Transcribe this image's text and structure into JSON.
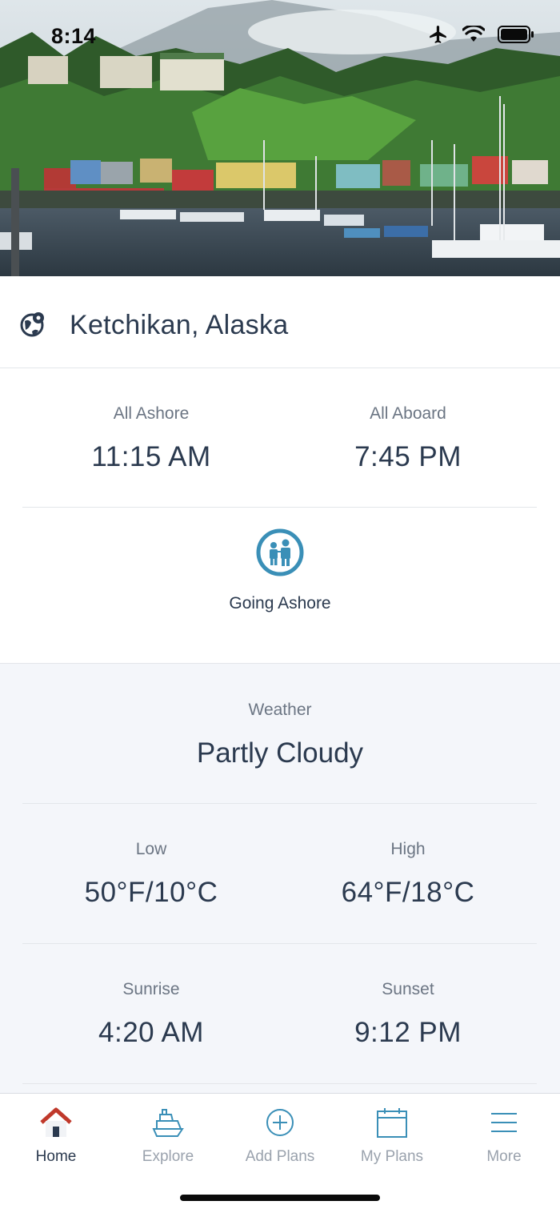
{
  "status_bar": {
    "time": "8:14",
    "icons": [
      "airplane-icon",
      "wifi-icon",
      "battery-icon"
    ]
  },
  "location": {
    "icon": "globe-pin-icon",
    "name": "Ketchikan, Alaska"
  },
  "port_times": {
    "all_ashore_label": "All Ashore",
    "all_ashore_value": "11:15 AM",
    "all_aboard_label": "All Aboard",
    "all_aboard_value": "7:45 PM"
  },
  "going_ashore": {
    "icon": "people-icon",
    "label": "Going Ashore"
  },
  "weather": {
    "label": "Weather",
    "condition": "Partly Cloudy",
    "low_label": "Low",
    "low_value": "50°F/10°C",
    "high_label": "High",
    "high_value": "64°F/18°C",
    "sunrise_label": "Sunrise",
    "sunrise_value": "4:20 AM",
    "sunset_label": "Sunset",
    "sunset_value": "9:12 PM"
  },
  "tabbar": {
    "tabs": [
      {
        "label": "Home",
        "icon": "home-icon",
        "active": true
      },
      {
        "label": "Explore",
        "icon": "ship-icon",
        "active": false
      },
      {
        "label": "Add Plans",
        "icon": "plus-circle-icon",
        "active": false
      },
      {
        "label": "My Plans",
        "icon": "calendar-icon",
        "active": false
      },
      {
        "label": "More",
        "icon": "menu-icon",
        "active": false
      }
    ]
  },
  "colors": {
    "accent": "#3a8fb7",
    "text_primary": "#2b3a4f",
    "text_secondary": "#6b7583",
    "home_roof": "#c0392b",
    "weather_bg": "#f4f6fa"
  }
}
